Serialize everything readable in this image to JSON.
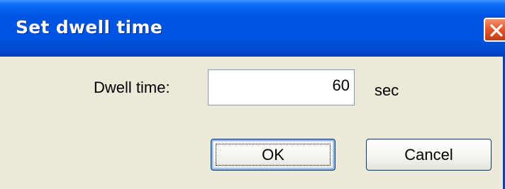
{
  "dialog": {
    "title": "Set dwell time",
    "close_icon": "close-icon",
    "field_label": "Dwell time:",
    "field_value": "60",
    "unit": "sec",
    "ok_label": "OK",
    "cancel_label": "Cancel"
  },
  "colors": {
    "titlebar": "#0054e3",
    "dialog_background": "#ece9d8",
    "close_button": "#e55a2f",
    "input_border": "#7f9db9",
    "button_border": "#003c74"
  }
}
